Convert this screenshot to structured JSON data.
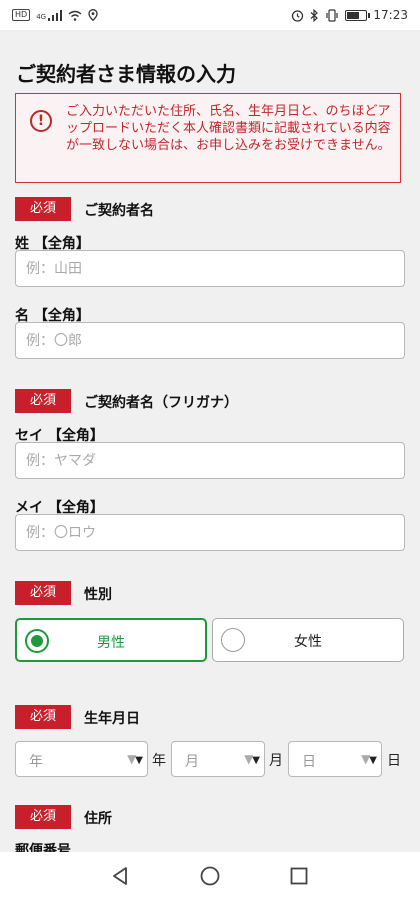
{
  "status_bar": {
    "hd": "HD",
    "network": "4G",
    "time": "17:23",
    "left_icons": [
      "signal-icon",
      "wifi-icon",
      "location-icon"
    ],
    "right_icons": [
      "alarm-icon",
      "bluetooth-icon",
      "vibrate-icon",
      "battery-icon"
    ]
  },
  "page": {
    "title": "ご契約者さま情報の入力",
    "alert": {
      "icon": "exclamation-icon",
      "message": "ご入力いただいた住所、氏名、生年月日と、のちほどアップロードいただく本人確認書類に記載されている内容が一致しない場合は、お申し込みをお受けできません。"
    }
  },
  "sections": {
    "name": {
      "badge": "必須",
      "title": "ご契約者名",
      "last_label": "姓 【全角】",
      "last_placeholder": "例：山田",
      "last_value": "",
      "first_label": "名 【全角】",
      "first_placeholder": "例：〇郎",
      "first_value": ""
    },
    "kana": {
      "badge": "必須",
      "title": "ご契約者名（フリガナ）",
      "last_label": "セイ 【全角】",
      "last_placeholder": "例：ヤマダ",
      "last_value": "",
      "first_label": "メイ 【全角】",
      "first_placeholder": "例：〇ロウ",
      "first_value": ""
    },
    "gender": {
      "badge": "必須",
      "title": "性別",
      "options": [
        {
          "label": "男性",
          "selected": true
        },
        {
          "label": "女性",
          "selected": false
        }
      ]
    },
    "birthdate": {
      "badge": "必須",
      "title": "生年月日",
      "year_placeholder": "年",
      "year_unit": "年",
      "month_placeholder": "月",
      "month_unit": "月",
      "day_placeholder": "日",
      "day_unit": "日"
    },
    "address": {
      "badge": "必須",
      "title": "住所",
      "postal_label": "郵便番号"
    }
  },
  "colors": {
    "badge_red": "#c91f2c",
    "alert_red": "#c0272d",
    "selected_green": "#1f9a3a"
  },
  "nav_bar": [
    "back-icon",
    "home-icon",
    "recents-icon"
  ]
}
